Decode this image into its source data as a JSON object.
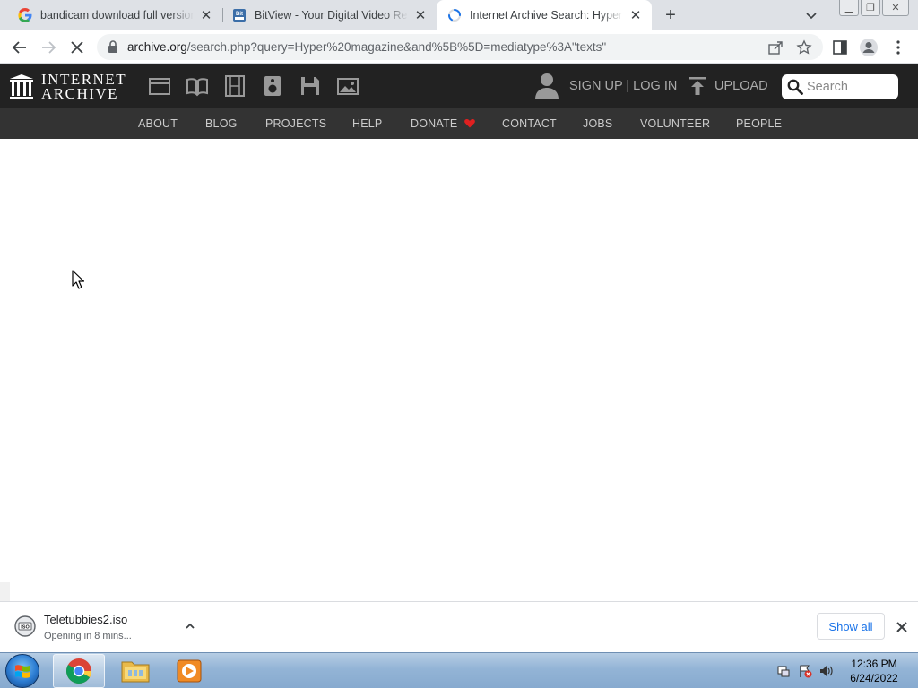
{
  "browser": {
    "tabs": [
      {
        "title": "bandicam download full version",
        "favicon": "google-icon"
      },
      {
        "title": "BitView - Your Digital Video Repository",
        "favicon": "bitview-icon"
      },
      {
        "title": "Internet Archive Search: Hyper magazine",
        "favicon": "loading-spinner-icon",
        "active": true
      }
    ],
    "url_host": "archive.org",
    "url_path": "/search.php?query=Hyper%20magazine&and%5B%5D=mediatype%3A\"texts\""
  },
  "ia": {
    "logo_line1": "INTERNET",
    "logo_line2": "ARCHIVE",
    "media_icons": [
      "web-icon",
      "texts-icon",
      "video-icon",
      "audio-icon",
      "software-icon",
      "images-icon"
    ],
    "signup_label": "SIGN UP | LOG IN",
    "upload_label": "UPLOAD",
    "search_placeholder": "Search",
    "nav": [
      "ABOUT",
      "BLOG",
      "PROJECTS",
      "HELP",
      "DONATE",
      "CONTACT",
      "JOBS",
      "VOLUNTEER",
      "PEOPLE"
    ],
    "donate_heart_color": "#e02020"
  },
  "downloads": {
    "file_name": "Teletubbies2.iso",
    "status": "Opening in 8 mins...",
    "show_all_label": "Show all"
  },
  "taskbar": {
    "apps": [
      "chrome-icon",
      "explorer-folder-icon",
      "media-player-icon"
    ],
    "time": "12:36 PM",
    "date": "6/24/2022"
  }
}
